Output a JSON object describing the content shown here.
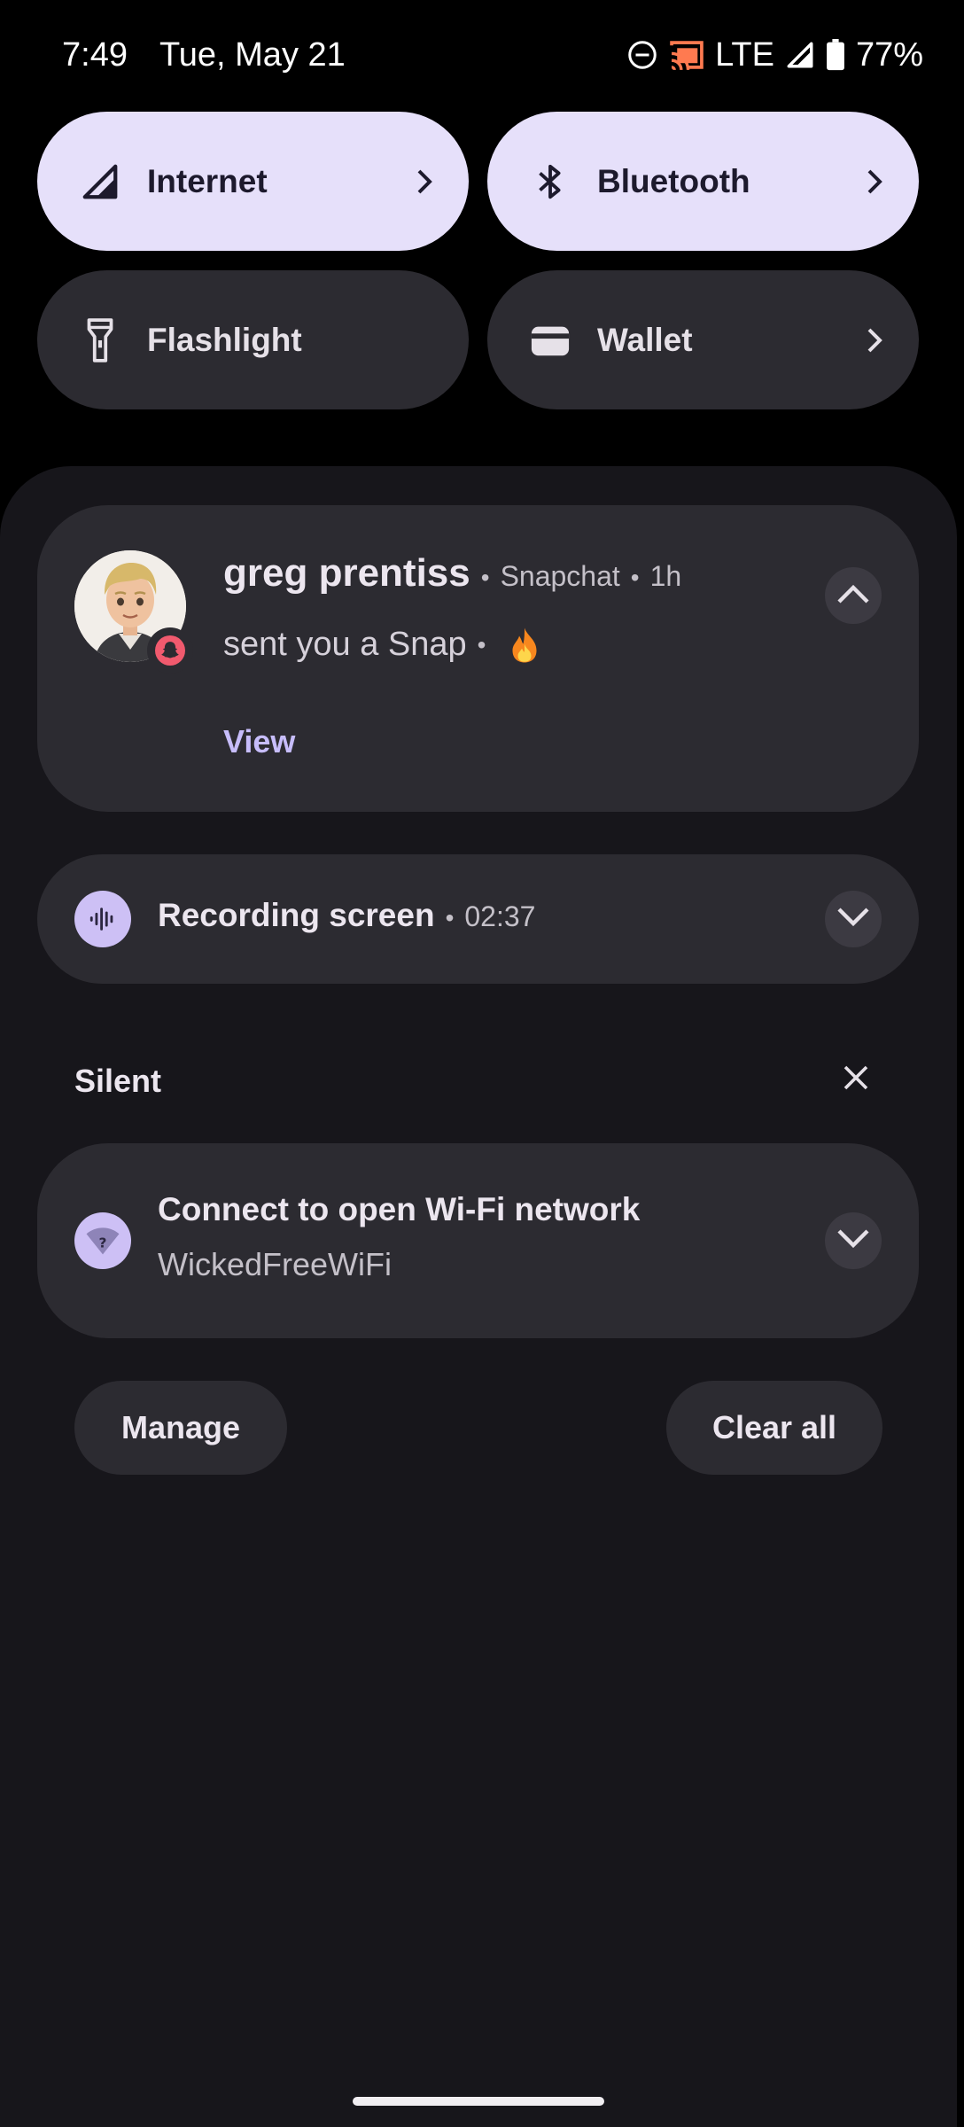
{
  "status_bar": {
    "time": "7:49",
    "date": "Tue, May 21",
    "network": "LTE",
    "battery": "77%",
    "icons": [
      "do-not-disturb-icon",
      "cast-icon",
      "signal-icon",
      "battery-icon"
    ]
  },
  "quick_tiles": [
    {
      "label": "Internet",
      "icon": "signal-icon",
      "active": true,
      "has_chevron": true
    },
    {
      "label": "Bluetooth",
      "icon": "bluetooth-icon",
      "active": true,
      "has_chevron": true
    },
    {
      "label": "Flashlight",
      "icon": "flashlight-icon",
      "active": false,
      "has_chevron": false
    },
    {
      "label": "Wallet",
      "icon": "wallet-icon",
      "active": false,
      "has_chevron": true
    }
  ],
  "snap_notification": {
    "sender": "greg prentiss",
    "app": "Snapchat",
    "time": "1h",
    "message": "sent you a Snap",
    "emoji": "fire-emoji",
    "action": "View"
  },
  "recording_notification": {
    "title": "Recording screen",
    "elapsed": "02:37"
  },
  "silent_section": {
    "label": "Silent"
  },
  "wifi_notification": {
    "title": "Connect to open Wi-Fi network",
    "network_name": "WickedFreeWiFi"
  },
  "footer": {
    "manage_label": "Manage",
    "clear_all_label": "Clear all"
  },
  "colors": {
    "background": "#000000",
    "shade": "#17161b",
    "card": "#2c2b31",
    "tile_active": "#e6e0fa",
    "accent": "#c7bdfb",
    "icon_circle": "#cdc0f5"
  }
}
